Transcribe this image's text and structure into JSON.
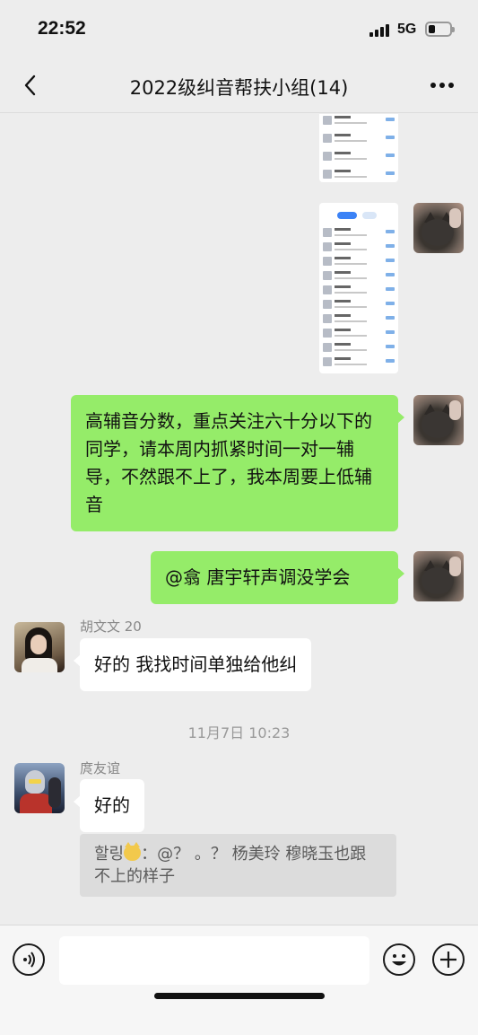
{
  "status": {
    "time": "22:52",
    "network": "5G"
  },
  "header": {
    "title": "2022级纠音帮扶小组(14)"
  },
  "messages": {
    "green1": "高辅音分数，重点关注六十分以下的同学，请本周内抓紧时间一对一辅导，不然跟不上了，我本周要上低辅音",
    "green2": "@翕 唐宇轩声调没学会",
    "hu_name": "胡文文 20",
    "hu_text": "好的 我找时间单独给他纠",
    "timestamp": "11月7日 10:23",
    "pang_name": "庹友谊",
    "pang_text": "好的",
    "quote_name": "할링",
    "quote_text": "：@？ 。？ 杨美玲 穆晓玉也跟不上的样子"
  },
  "icons": {
    "back": "chevron-left-icon",
    "more": "more-icon",
    "voice": "voice-icon",
    "emoji": "emoji-icon",
    "add": "plus-icon"
  },
  "colors": {
    "green_bubble": "#95ec69",
    "background": "#ededed"
  }
}
